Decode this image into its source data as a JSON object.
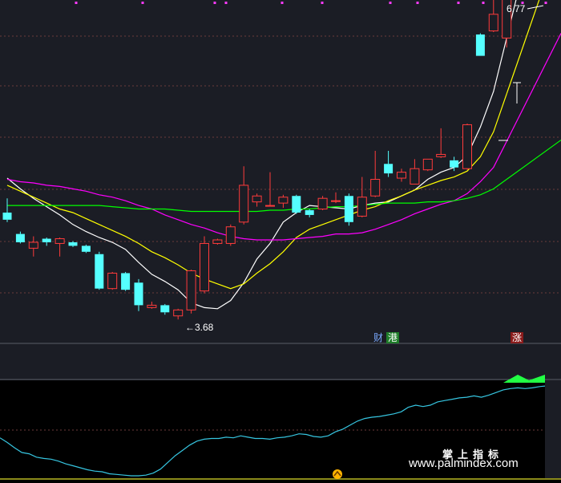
{
  "chart_data": [
    {
      "type": "candlestick",
      "title": "",
      "ylim": [
        3.3,
        6.9
      ],
      "grid": "horizontal dashed",
      "candles": [
        {
          "o": 4.58,
          "h": 4.7,
          "l": 4.5,
          "c": 4.52
        },
        {
          "o": 4.4,
          "h": 4.42,
          "l": 4.32,
          "c": 4.33
        },
        {
          "o": 4.28,
          "h": 4.38,
          "l": 4.21,
          "c": 4.33
        },
        {
          "o": 4.36,
          "h": 4.37,
          "l": 4.3,
          "c": 4.33
        },
        {
          "o": 4.32,
          "h": 4.37,
          "l": 4.21,
          "c": 4.36
        },
        {
          "o": 4.33,
          "h": 4.34,
          "l": 4.29,
          "c": 4.3
        },
        {
          "o": 4.3,
          "h": 4.31,
          "l": 4.24,
          "c": 4.25
        },
        {
          "o": 4.23,
          "h": 4.25,
          "l": 3.93,
          "c": 3.94
        },
        {
          "o": 3.94,
          "h": 4.08,
          "l": 3.93,
          "c": 4.07
        },
        {
          "o": 4.07,
          "h": 4.08,
          "l": 3.92,
          "c": 3.93
        },
        {
          "o": 3.99,
          "h": 4.02,
          "l": 3.75,
          "c": 3.8
        },
        {
          "o": 3.78,
          "h": 3.83,
          "l": 3.77,
          "c": 3.8
        },
        {
          "o": 3.8,
          "h": 3.81,
          "l": 3.72,
          "c": 3.74
        },
        {
          "o": 3.71,
          "h": 3.77,
          "l": 3.68,
          "c": 3.76
        },
        {
          "o": 3.76,
          "h": 4.1,
          "l": 3.73,
          "c": 4.09
        },
        {
          "o": 3.92,
          "h": 4.38,
          "l": 3.9,
          "c": 4.32
        },
        {
          "o": 4.32,
          "h": 4.36,
          "l": 4.31,
          "c": 4.35
        },
        {
          "o": 4.32,
          "h": 4.48,
          "l": 4.3,
          "c": 4.46
        },
        {
          "o": 4.5,
          "h": 4.97,
          "l": 4.48,
          "c": 4.81
        },
        {
          "o": 4.67,
          "h": 4.74,
          "l": 4.63,
          "c": 4.72
        },
        {
          "o": 4.64,
          "h": 4.92,
          "l": 4.64,
          "c": 4.64
        },
        {
          "o": 4.66,
          "h": 4.73,
          "l": 4.62,
          "c": 4.71
        },
        {
          "o": 4.72,
          "h": 4.73,
          "l": 4.57,
          "c": 4.58
        },
        {
          "o": 4.6,
          "h": 4.61,
          "l": 4.54,
          "c": 4.56
        },
        {
          "o": 4.61,
          "h": 4.72,
          "l": 4.6,
          "c": 4.7
        },
        {
          "o": 4.68,
          "h": 4.75,
          "l": 4.66,
          "c": 4.68
        },
        {
          "o": 4.72,
          "h": 4.74,
          "l": 4.47,
          "c": 4.5
        },
        {
          "o": 4.55,
          "h": 4.88,
          "l": 4.54,
          "c": 4.71
        },
        {
          "o": 4.72,
          "h": 5.1,
          "l": 4.71,
          "c": 4.86
        },
        {
          "o": 4.99,
          "h": 5.1,
          "l": 4.88,
          "c": 4.91
        },
        {
          "o": 4.87,
          "h": 4.95,
          "l": 4.84,
          "c": 4.92
        },
        {
          "o": 4.82,
          "h": 5.03,
          "l": 4.82,
          "c": 4.95
        },
        {
          "o": 4.94,
          "h": 5.03,
          "l": 4.93,
          "c": 5.03
        },
        {
          "o": 5.05,
          "h": 5.29,
          "l": 5.04,
          "c": 5.07
        },
        {
          "o": 5.02,
          "h": 5.05,
          "l": 4.93,
          "c": 4.96
        },
        {
          "o": 4.95,
          "h": 5.33,
          "l": 4.94,
          "c": 5.32
        },
        {
          "o": 6.08,
          "h": 6.09,
          "l": 5.9,
          "c": 5.9
        },
        {
          "o": 6.11,
          "h": 6.43,
          "l": 6.1,
          "c": 6.25
        },
        {
          "o": 6.05,
          "h": 6.77,
          "l": 5.97,
          "c": 6.77
        }
      ],
      "ma": [
        {
          "name": "MA5",
          "color": "#ffffff",
          "values": [
            4.87,
            4.78,
            4.7,
            4.63,
            4.56,
            4.48,
            4.42,
            4.37,
            4.33,
            4.27,
            4.16,
            4.06,
            4.0,
            3.93,
            3.82,
            3.78,
            3.77,
            3.84,
            3.99,
            4.19,
            4.32,
            4.5,
            4.58,
            4.64,
            4.63,
            4.62,
            4.61,
            4.64,
            4.66,
            4.67,
            4.72,
            4.77,
            4.86,
            4.92,
            4.96,
            5.06,
            5.3,
            5.6,
            6.05
          ]
        },
        {
          "name": "MA10",
          "color": "#ffff00",
          "values": [
            4.81,
            4.76,
            4.71,
            4.66,
            4.61,
            4.58,
            4.53,
            4.48,
            4.43,
            4.38,
            4.32,
            4.25,
            4.2,
            4.14,
            4.07,
            4.02,
            3.98,
            3.94,
            3.98,
            4.07,
            4.15,
            4.25,
            4.37,
            4.44,
            4.48,
            4.52,
            4.56,
            4.6,
            4.63,
            4.68,
            4.72,
            4.77,
            4.81,
            4.85,
            4.88,
            4.93,
            5.05,
            5.26,
            5.58
          ]
        },
        {
          "name": "MA20",
          "color": "#ff00ff",
          "values": [
            4.86,
            4.84,
            4.83,
            4.81,
            4.8,
            4.78,
            4.76,
            4.73,
            4.71,
            4.68,
            4.64,
            4.61,
            4.56,
            4.52,
            4.48,
            4.45,
            4.41,
            4.38,
            4.36,
            4.35,
            4.35,
            4.35,
            4.36,
            4.37,
            4.38,
            4.4,
            4.4,
            4.41,
            4.44,
            4.48,
            4.52,
            4.57,
            4.61,
            4.65,
            4.68,
            4.74,
            4.84,
            4.96,
            5.18
          ]
        },
        {
          "name": "MA60",
          "color": "#00ff00",
          "values": [
            4.64,
            4.64,
            4.64,
            4.64,
            4.64,
            4.64,
            4.64,
            4.64,
            4.63,
            4.62,
            4.61,
            4.61,
            4.61,
            4.6,
            4.59,
            4.59,
            4.59,
            4.59,
            4.59,
            4.59,
            4.6,
            4.6,
            4.61,
            4.61,
            4.62,
            4.63,
            4.63,
            4.64,
            4.65,
            4.66,
            4.66,
            4.66,
            4.67,
            4.67,
            4.68,
            4.7,
            4.73,
            4.78,
            4.86
          ]
        }
      ],
      "annotations": {
        "high_label": "6.77",
        "low_label": "←3.68",
        "low_index": 13,
        "high_index": 38
      }
    },
    {
      "type": "line",
      "ylim": [
        0,
        100
      ],
      "line_color": "#36c5e0",
      "values": [
        57,
        50,
        42,
        35,
        33,
        28,
        26,
        25,
        22,
        18,
        15,
        12,
        9,
        7,
        6,
        3,
        2,
        1,
        0,
        0,
        1,
        4,
        10,
        20,
        30,
        38,
        46,
        52,
        55,
        56,
        56,
        58,
        57,
        60,
        58,
        56,
        56,
        55,
        57,
        58,
        60,
        63,
        62,
        59,
        58,
        60,
        66,
        70,
        76,
        82,
        86,
        88,
        89,
        91,
        93,
        96,
        103,
        106,
        104,
        106,
        111,
        113,
        115,
        117,
        118,
        120,
        118,
        121,
        125,
        129,
        131,
        132,
        131,
        132,
        134,
        135
      ],
      "bar_values": [
        0,
        0,
        0,
        0,
        0,
        0,
        0,
        0,
        0,
        0,
        0,
        0,
        0,
        0,
        0,
        0,
        0,
        0,
        0,
        0,
        0,
        0,
        0,
        0,
        0,
        0,
        0,
        0,
        0,
        0,
        0,
        0,
        0,
        0,
        0,
        0,
        0,
        0,
        0,
        0,
        0,
        0,
        0,
        0,
        0,
        0,
        0,
        0,
        0,
        0,
        0,
        0,
        0,
        0,
        0,
        0,
        0,
        0,
        0,
        0,
        0,
        0,
        0,
        0,
        0,
        0,
        0,
        0,
        0,
        0,
        0,
        0,
        0,
        0,
        0,
        0
      ]
    }
  ],
  "tags": {
    "cai": "财",
    "gang": "港",
    "zhang": "涨"
  },
  "watermark": {
    "cn": "掌上指标",
    "url": "www.palmindex.com"
  },
  "colors": {
    "up": "#ff3b3b",
    "down": "#55ffff",
    "bg": "#1b1d25",
    "grid": "#6b3a3a"
  }
}
